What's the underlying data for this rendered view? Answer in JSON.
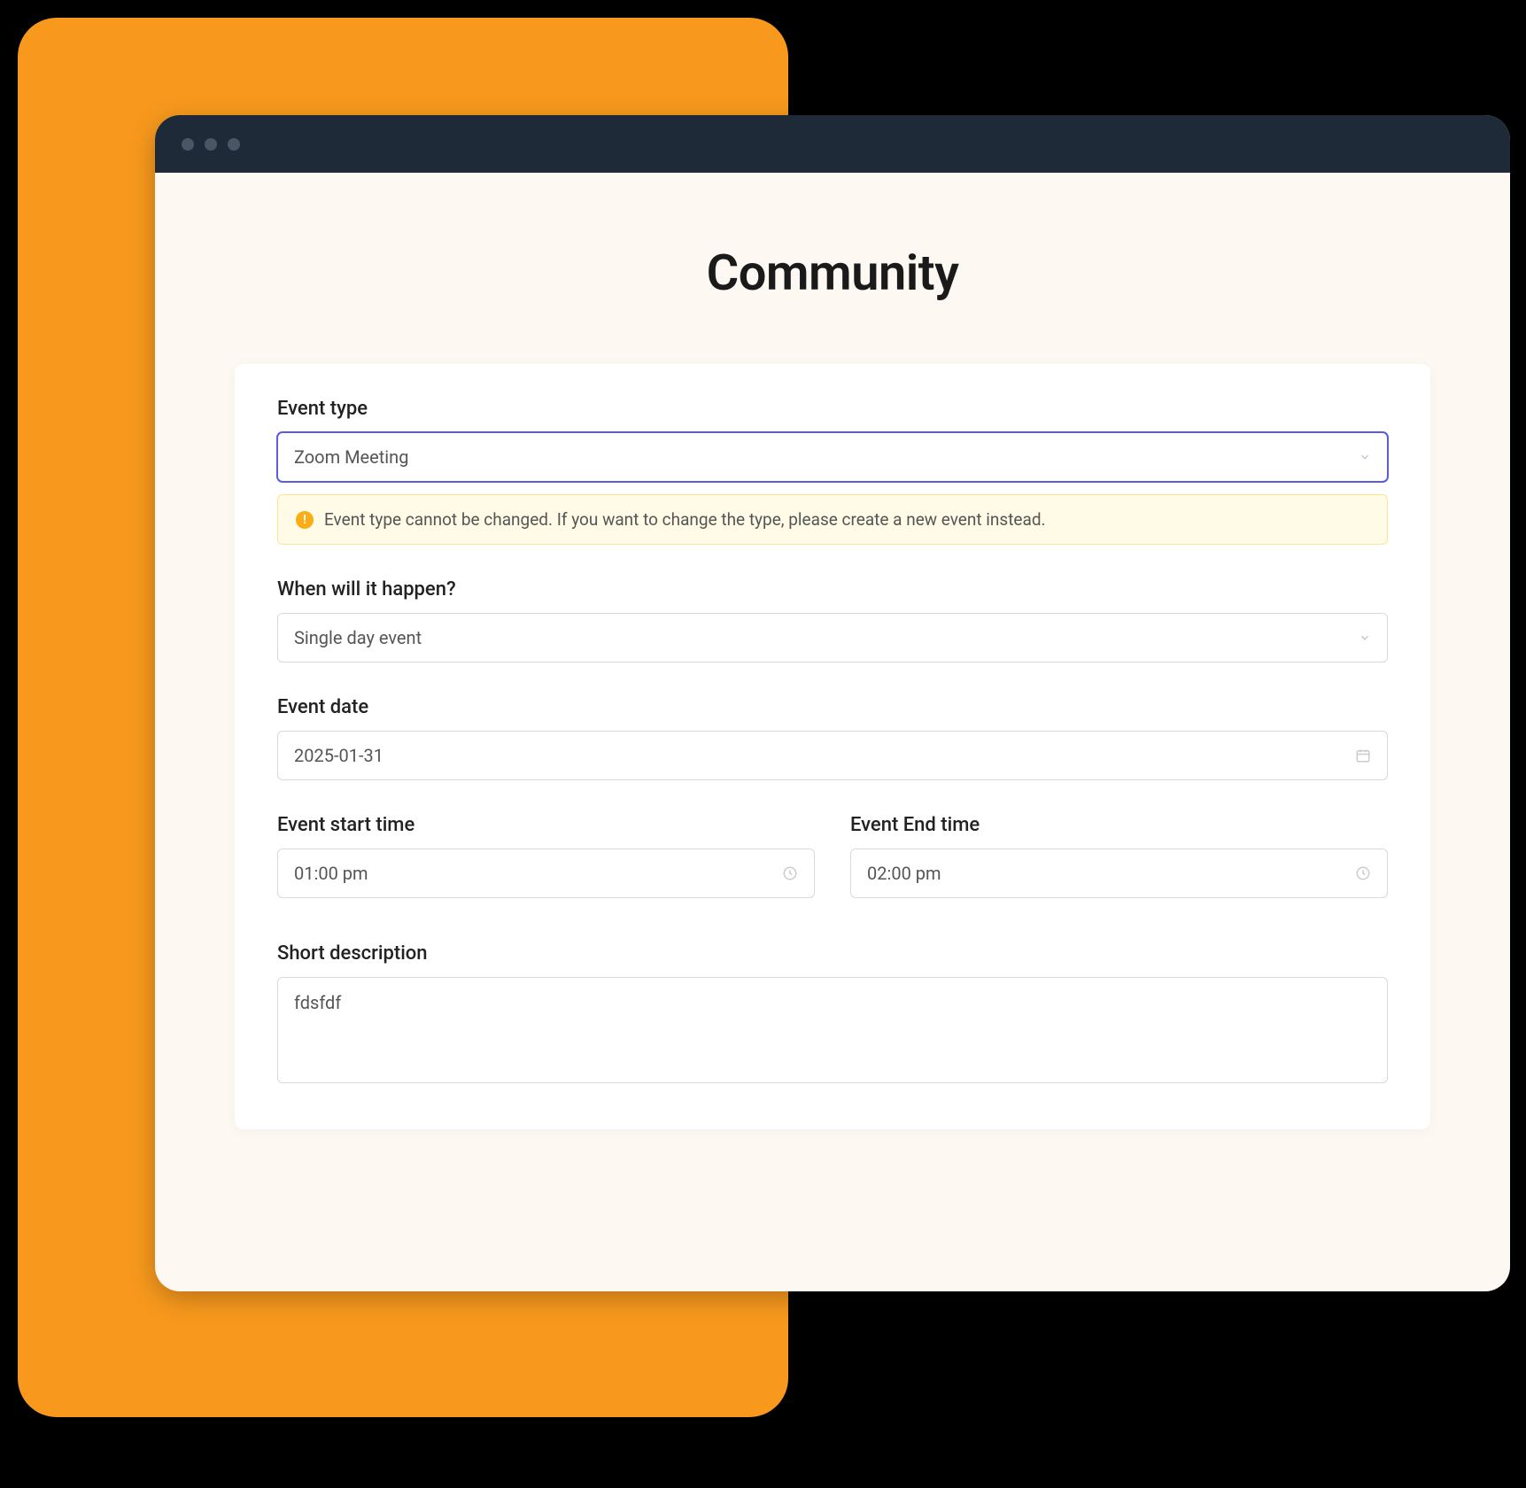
{
  "colors": {
    "accent": "#F8991D",
    "titlebar": "#1E2A38",
    "page_bg": "#FDF8F2",
    "highlight_border": "#5B5BE0",
    "warning_bg": "#FFFBE6",
    "warning_border": "#FFE58F",
    "warning_icon": "#FAAD14"
  },
  "page": {
    "title": "Community"
  },
  "form": {
    "event_type": {
      "label": "Event type",
      "value": "Zoom Meeting"
    },
    "warning": {
      "text": "Event type cannot be changed. If you want to change the type, please create a new event instead."
    },
    "when": {
      "label": "When will it happen?",
      "value": "Single day event"
    },
    "event_date": {
      "label": "Event date",
      "value": "2025-01-31"
    },
    "start_time": {
      "label": "Event start time",
      "value": "01:00 pm"
    },
    "end_time": {
      "label": "Event End time",
      "value": "02:00 pm"
    },
    "short_desc": {
      "label": "Short description",
      "value": "fdsfdf"
    }
  }
}
